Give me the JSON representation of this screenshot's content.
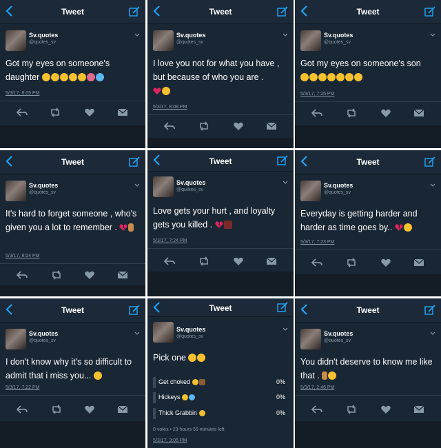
{
  "panels": [
    {
      "title": "Tweet",
      "name": "Sv.quotes",
      "handle": "@quotes_sv",
      "text": "Got my eyes on someone's daughter",
      "date": "5/3/17, 8:05 PM"
    },
    {
      "title": "Tweet",
      "name": "Sv.quotes",
      "handle": "@quotes_sv",
      "text": "I love you not for what you have , but because of who you are .",
      "date": "5/3/17, 8:08 PM"
    },
    {
      "title": "Tweet",
      "name": "Sv.quotes",
      "handle": "@quotes_sv",
      "text": "Got my eyes on someone's son",
      "date": "5/3/17, 7:25 PM"
    },
    {
      "title": "Tweet",
      "name": "Sv.quotes",
      "handle": "@quotes_sv",
      "text": "It's hard to forget someone , who's given you a lot to remember .",
      "date": "5/3/17, 8:04 PM"
    },
    {
      "title": "Tweet",
      "name": "Sv.quotes",
      "handle": "@quotes_sv",
      "text": "Love gets your hurt , and loyalty gets you killed .",
      "date": "5/3/17, 7:24 PM"
    },
    {
      "title": "Tweet",
      "name": "Sv.quotes",
      "handle": "@quotes_sv",
      "text": "Everyday is getting harder and harder as time goes by..",
      "date": "5/3/17, 7:23 PM"
    },
    {
      "title": "Tweet",
      "name": "Sv.quotes",
      "handle": "@quotes_sv",
      "text": "I don't know why it's so difficult to admit that i miss you...",
      "date": "5/3/17, 7:22 PM"
    },
    {
      "title": "Tweet",
      "name": "Sv.quotes",
      "handle": "@quotes_sv",
      "text": "Pick one",
      "date": "5/3/17, 3:05 PM",
      "poll": {
        "options": [
          {
            "label": "Get choked",
            "pct": "0%"
          },
          {
            "label": "Hickeys",
            "pct": "0%"
          },
          {
            "label": "Thick Grabbin",
            "pct": "0%"
          }
        ],
        "meta": "0 votes • 23 hours 59 minutes left"
      }
    },
    {
      "title": "Tweet",
      "name": "Sv.quotes",
      "handle": "@quotes_sv",
      "text": "You didn't deserve to know me like that .",
      "date": "5/3/17, 2:46 PM"
    }
  ],
  "colors": {
    "bg": "#192734",
    "accent": "#1da1f2",
    "text": "#ffffff",
    "muted": "#8899a6"
  }
}
